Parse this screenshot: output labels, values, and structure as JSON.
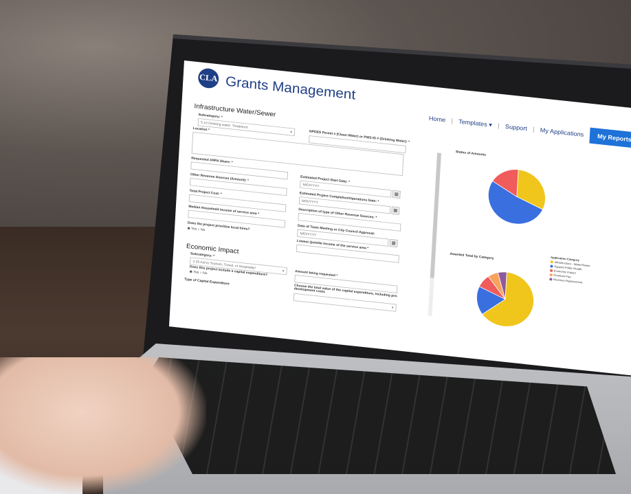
{
  "header": {
    "logo_text": "CLA",
    "app_title": "Grants Management",
    "nav": [
      "Home",
      "Templates ▾",
      "Support",
      "My Applications"
    ],
    "reports_label": "My Reports ▾"
  },
  "section1": {
    "title": "Infrastructure Water/Sewer",
    "subcategory_label": "Subcategory: *",
    "subcategory_value": "5.10 Drinking water: Treatment",
    "npdes_label": "NPDES Permit # (Clean Water) or PWS ID # (Drinking Water): *",
    "location_label": "Location *",
    "arpa_label": "Requested ARPA Share: *",
    "start_date_label": "Estimated Project Start Date: *",
    "date_placeholder": "M/D/YYYY",
    "other_revenue_label": "Other Revenue Sources (Amount): *",
    "completion_label": "Estimated Project Completion/Operations Date: *",
    "total_cost_label": "Total Project Cost: *",
    "description_label": "Description of type of Other Revenue Sources: *",
    "median_income_label": "Median Household Income of service area *",
    "town_meeting_label": "Date of Town Meeting or City Council Approval:",
    "local_hires_label": "Does the project prioritize local hires?",
    "yes": "Yes",
    "no": "No",
    "quintile_label": "Lowest Quintile Income of the service area *"
  },
  "section2": {
    "title": "Economic Impact",
    "subcategory_label": "Subcategory: *",
    "subcategory_value": "2.35 Aid to Tourism, Travel, or Hospitality*",
    "amount_label": "Amount being requested *",
    "capital_label": "Does this project include a capital expenditure?",
    "total_value_label": "Choose the total value of the capital expenditure, including pre-development costs",
    "type_label": "Type of Capital Expenditure"
  },
  "chart_data": [
    {
      "type": "pie",
      "title": "Status of Amounts",
      "values": [
        31,
        52,
        17
      ],
      "colors": [
        "#f0c51c",
        "#3a6fe0",
        "#f05b5b"
      ]
    },
    {
      "type": "pie",
      "title": "Awarded Total by Category",
      "legend_title": "Application Category",
      "legend": [
        "Infrastructure - Water/Sewer",
        "Support Public Health",
        "Economic Impact",
        "Premium Pay",
        "Revenue Replacement"
      ],
      "values": [
        64,
        17,
        8,
        6,
        5
      ],
      "colors": [
        "#f0c51c",
        "#3a6fe0",
        "#f05b5b",
        "#f7a35c",
        "#8c5a9e"
      ]
    }
  ]
}
